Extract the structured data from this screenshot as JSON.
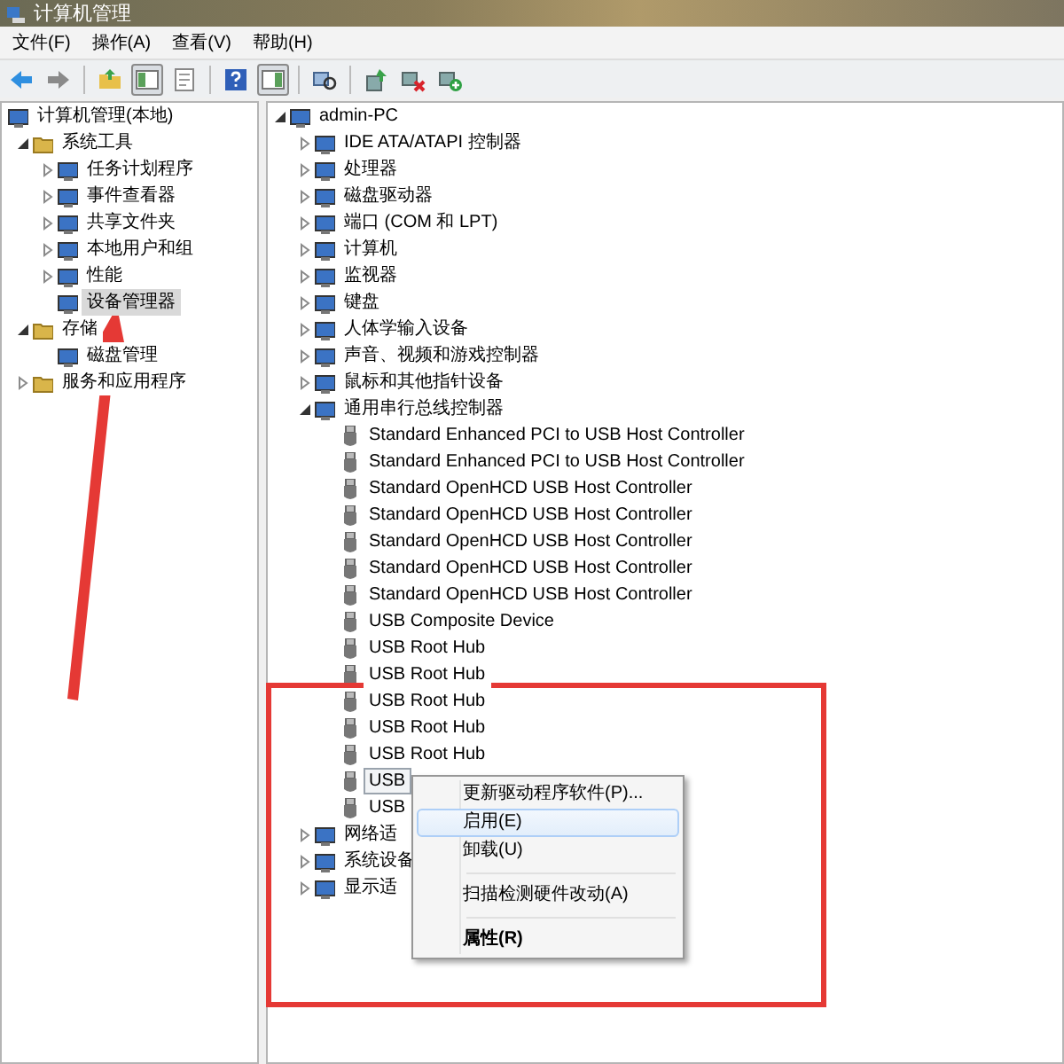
{
  "window": {
    "title": "计算机管理"
  },
  "menu": [
    {
      "label": "文件(F)"
    },
    {
      "label": "操作(A)"
    },
    {
      "label": "查看(V)"
    },
    {
      "label": "帮助(H)"
    }
  ],
  "toolbar": [
    {
      "kind": "back",
      "pressed": false
    },
    {
      "kind": "forward",
      "pressed": false
    },
    {
      "kind": "separator"
    },
    {
      "kind": "folder",
      "pressed": false
    },
    {
      "kind": "tree",
      "pressed": true
    },
    {
      "kind": "export",
      "pressed": false
    },
    {
      "kind": "separator"
    },
    {
      "kind": "help",
      "pressed": false
    },
    {
      "kind": "pane",
      "pressed": true
    },
    {
      "kind": "separator"
    },
    {
      "kind": "scan",
      "pressed": false
    },
    {
      "kind": "separator"
    },
    {
      "kind": "update",
      "pressed": false
    },
    {
      "kind": "remove",
      "pressed": false
    },
    {
      "kind": "enable",
      "pressed": false
    }
  ],
  "left_tree": [
    {
      "label": "计算机管理(本地)",
      "selected": false,
      "children": [
        {
          "label": "系统工具",
          "expanded": true,
          "selected": false,
          "children": [
            {
              "label": "任务计划程序",
              "expanded": false,
              "selected": false
            },
            {
              "label": "事件查看器",
              "expanded": false,
              "selected": false
            },
            {
              "label": "共享文件夹",
              "expanded": false,
              "selected": false
            },
            {
              "label": "本地用户和组",
              "expanded": false,
              "selected": false
            },
            {
              "label": "性能",
              "expanded": false,
              "selected": false
            },
            {
              "label": "设备管理器",
              "selected": true
            }
          ]
        },
        {
          "label": "存储",
          "expanded": true,
          "selected": false,
          "children": [
            {
              "label": "磁盘管理",
              "selected": false
            }
          ]
        },
        {
          "label": "服务和应用程序",
          "expanded": false,
          "selected": false
        }
      ]
    }
  ],
  "right_tree": [
    {
      "label": "admin-PC",
      "expanded": true,
      "selected": false,
      "children": [
        {
          "label": "IDE ATA/ATAPI 控制器",
          "expanded": false,
          "selected": false
        },
        {
          "label": "处理器",
          "expanded": false,
          "selected": false
        },
        {
          "label": "磁盘驱动器",
          "expanded": false,
          "selected": false
        },
        {
          "label": "端口 (COM 和 LPT)",
          "expanded": false,
          "selected": false
        },
        {
          "label": "计算机",
          "expanded": false,
          "selected": false
        },
        {
          "label": "监视器",
          "expanded": false,
          "selected": false
        },
        {
          "label": "键盘",
          "expanded": false,
          "selected": false
        },
        {
          "label": "人体学输入设备",
          "expanded": false,
          "selected": false
        },
        {
          "label": "声音、视频和游戏控制器",
          "expanded": false,
          "selected": false
        },
        {
          "label": "鼠标和其他指针设备",
          "expanded": false,
          "selected": false
        },
        {
          "label": "通用串行总线控制器",
          "expanded": true,
          "selected": false,
          "children": [
            {
              "label": "Standard Enhanced PCI to USB Host Controller",
              "selected": false
            },
            {
              "label": "Standard Enhanced PCI to USB Host Controller",
              "selected": false
            },
            {
              "label": "Standard OpenHCD USB Host Controller",
              "selected": false
            },
            {
              "label": "Standard OpenHCD USB Host Controller",
              "selected": false
            },
            {
              "label": "Standard OpenHCD USB Host Controller",
              "selected": false
            },
            {
              "label": "Standard OpenHCD USB Host Controller",
              "selected": false
            },
            {
              "label": "Standard OpenHCD USB Host Controller",
              "selected": false
            },
            {
              "label": "USB Composite Device",
              "selected": false
            },
            {
              "label": "USB Root Hub",
              "selected": false
            },
            {
              "label": "USB Root Hub",
              "selected": false
            },
            {
              "label": "USB Root Hub",
              "selected": false
            },
            {
              "label": "USB Root Hub",
              "selected": false
            },
            {
              "label": "USB Root Hub",
              "selected": false
            },
            {
              "label": "USB",
              "selected": true
            },
            {
              "label": "USB",
              "selected": false
            }
          ]
        },
        {
          "label": "网络适",
          "expanded": false,
          "selected": false
        },
        {
          "label": "系统设备",
          "expanded": false,
          "selected": false
        },
        {
          "label": "显示适",
          "expanded": false,
          "selected": false
        }
      ]
    }
  ],
  "context_menu": [
    {
      "kind": "item",
      "label": "更新驱动程序软件(P)...",
      "selected": false,
      "default": false
    },
    {
      "kind": "item",
      "label": "启用(E)",
      "selected": true,
      "default": false
    },
    {
      "kind": "item",
      "label": "卸载(U)",
      "selected": false,
      "default": false
    },
    {
      "kind": "separator"
    },
    {
      "kind": "item",
      "label": "扫描检测硬件改动(A)",
      "selected": false,
      "default": false
    },
    {
      "kind": "separator"
    },
    {
      "kind": "item",
      "label": "属性(R)",
      "selected": false,
      "default": true
    }
  ],
  "annotations": {
    "arrow": {
      "color": "#e53935"
    },
    "frame": {
      "color": "#e53935"
    }
  }
}
